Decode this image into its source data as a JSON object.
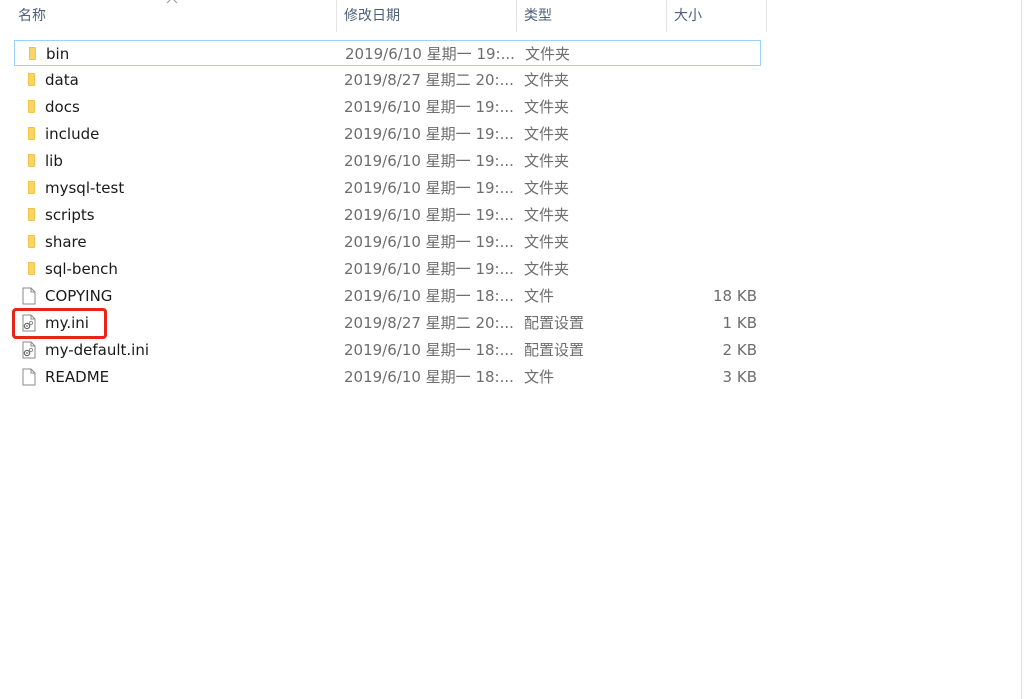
{
  "columns": {
    "name": "名称",
    "date": "修改日期",
    "type": "类型",
    "size": "大小"
  },
  "files": [
    {
      "name": "bin",
      "date": "2019/6/10 星期一 19:...",
      "type": "文件夹",
      "size": "",
      "icon": "folder-icon"
    },
    {
      "name": "data",
      "date": "2019/8/27 星期二 20:...",
      "type": "文件夹",
      "size": "",
      "icon": "folder-icon"
    },
    {
      "name": "docs",
      "date": "2019/6/10 星期一 19:...",
      "type": "文件夹",
      "size": "",
      "icon": "folder-icon"
    },
    {
      "name": "include",
      "date": "2019/6/10 星期一 19:...",
      "type": "文件夹",
      "size": "",
      "icon": "folder-icon"
    },
    {
      "name": "lib",
      "date": "2019/6/10 星期一 19:...",
      "type": "文件夹",
      "size": "",
      "icon": "folder-icon"
    },
    {
      "name": "mysql-test",
      "date": "2019/6/10 星期一 19:...",
      "type": "文件夹",
      "size": "",
      "icon": "folder-icon"
    },
    {
      "name": "scripts",
      "date": "2019/6/10 星期一 19:...",
      "type": "文件夹",
      "size": "",
      "icon": "folder-icon"
    },
    {
      "name": "share",
      "date": "2019/6/10 星期一 19:...",
      "type": "文件夹",
      "size": "",
      "icon": "folder-icon"
    },
    {
      "name": "sql-bench",
      "date": "2019/6/10 星期一 19:...",
      "type": "文件夹",
      "size": "",
      "icon": "folder-icon"
    },
    {
      "name": "COPYING",
      "date": "2019/6/10 星期一 18:...",
      "type": "文件",
      "size": "18 KB",
      "icon": "file-icon"
    },
    {
      "name": "my.ini",
      "date": "2019/8/27 星期二 20:...",
      "type": "配置设置",
      "size": "1 KB",
      "icon": "config-file-icon"
    },
    {
      "name": "my-default.ini",
      "date": "2019/6/10 星期一 18:...",
      "type": "配置设置",
      "size": "2 KB",
      "icon": "config-file-icon"
    },
    {
      "name": "README",
      "date": "2019/6/10 星期一 18:...",
      "type": "文件",
      "size": "3 KB",
      "icon": "file-icon"
    }
  ],
  "selected_index": 0,
  "highlighted_index": 10,
  "colors": {
    "folder": "#f5c342",
    "highlight": "#e8231a",
    "selection": "#99d1ff"
  }
}
